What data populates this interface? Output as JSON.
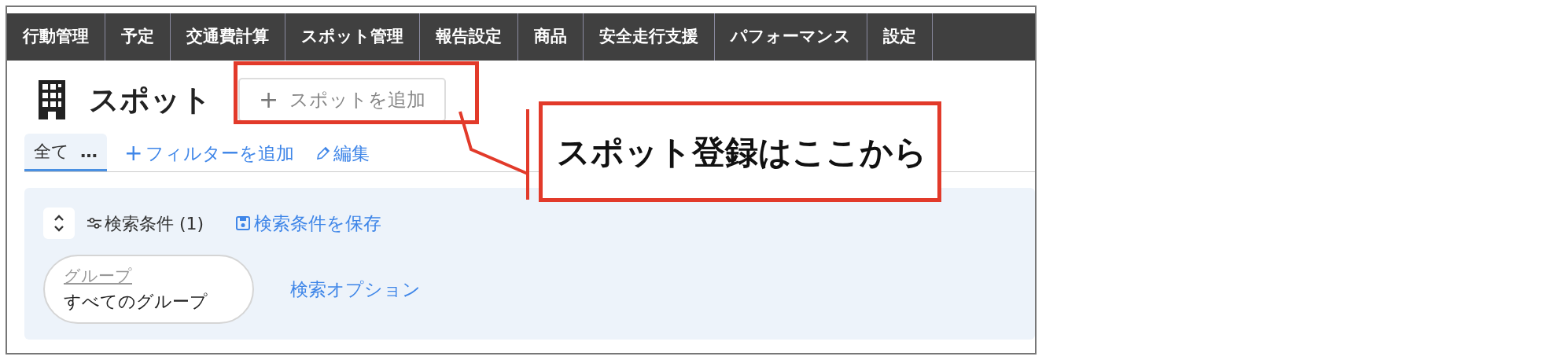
{
  "nav": [
    {
      "label": "行動管理"
    },
    {
      "label": "予定"
    },
    {
      "label": "交通費計算"
    },
    {
      "label": "スポット管理"
    },
    {
      "label": "報告設定"
    },
    {
      "label": "商品"
    },
    {
      "label": "安全走行支援"
    },
    {
      "label": "パフォーマンス"
    },
    {
      "label": "設定"
    }
  ],
  "page_title": "スポット",
  "add_button": {
    "icon": "+",
    "label": "スポットを追加"
  },
  "views": [
    {
      "label": "全て",
      "more": "…",
      "selected": true
    }
  ],
  "add_filter": {
    "icon": "+",
    "label": "フィルターを追加"
  },
  "edit_link": "編集",
  "search": {
    "label": "検索条件 (1)",
    "save_link": "検索条件を保存",
    "group": {
      "label": "グループ",
      "value": "すべてのグループ"
    },
    "options_link": "検索オプション"
  },
  "annotation": {
    "text": "スポット登録はここから"
  }
}
